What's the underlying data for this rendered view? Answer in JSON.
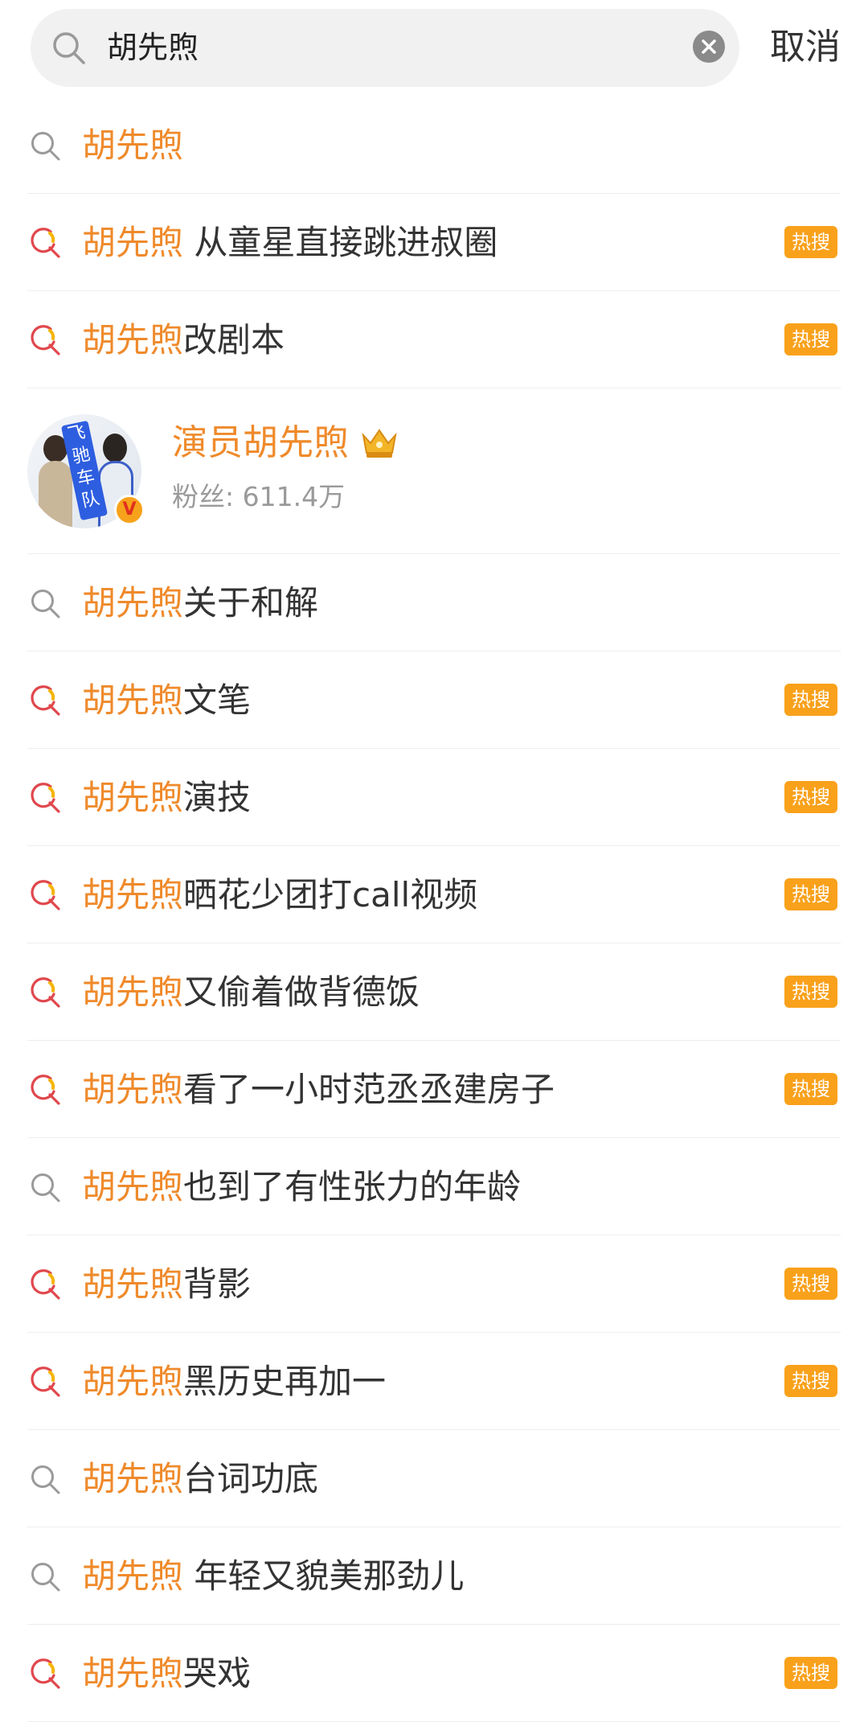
{
  "search": {
    "query": "胡先煦",
    "cancel_label": "取消"
  },
  "keyword": "胡先煦",
  "hot_badge": "热搜",
  "suggestions_top": [
    {
      "rest": "",
      "hot": false
    },
    {
      "rest": " 从童星直接跳进叔圈",
      "hot": true
    },
    {
      "rest": "改剧本",
      "hot": true
    }
  ],
  "user_card": {
    "name": "演员胡先煦",
    "fans": "粉丝: 611.4万",
    "avatar_text": "飞驰车队"
  },
  "suggestions_bottom": [
    {
      "rest": "关于和解",
      "hot": false
    },
    {
      "rest": "文笔",
      "hot": true
    },
    {
      "rest": "演技",
      "hot": true
    },
    {
      "rest": "晒花少团打call视频",
      "hot": true
    },
    {
      "rest": "又偷着做背德饭",
      "hot": true
    },
    {
      "rest": "看了一小时范丞丞建房子",
      "hot": true
    },
    {
      "rest": "也到了有性张力的年龄",
      "hot": false
    },
    {
      "rest": "背影",
      "hot": true
    },
    {
      "rest": "黑历史再加一",
      "hot": true
    },
    {
      "rest": "台词功底",
      "hot": false
    },
    {
      "rest": " 年轻又貌美那劲儿",
      "hot": false
    },
    {
      "rest": "哭戏",
      "hot": true
    }
  ],
  "colors": {
    "keyword": "#ef8a2b",
    "hot_badge": "#f9a11b",
    "hot_icon": "#e0474c",
    "hot_icon_accent": "#f5b400",
    "plain_icon": "#9a9a9a"
  }
}
